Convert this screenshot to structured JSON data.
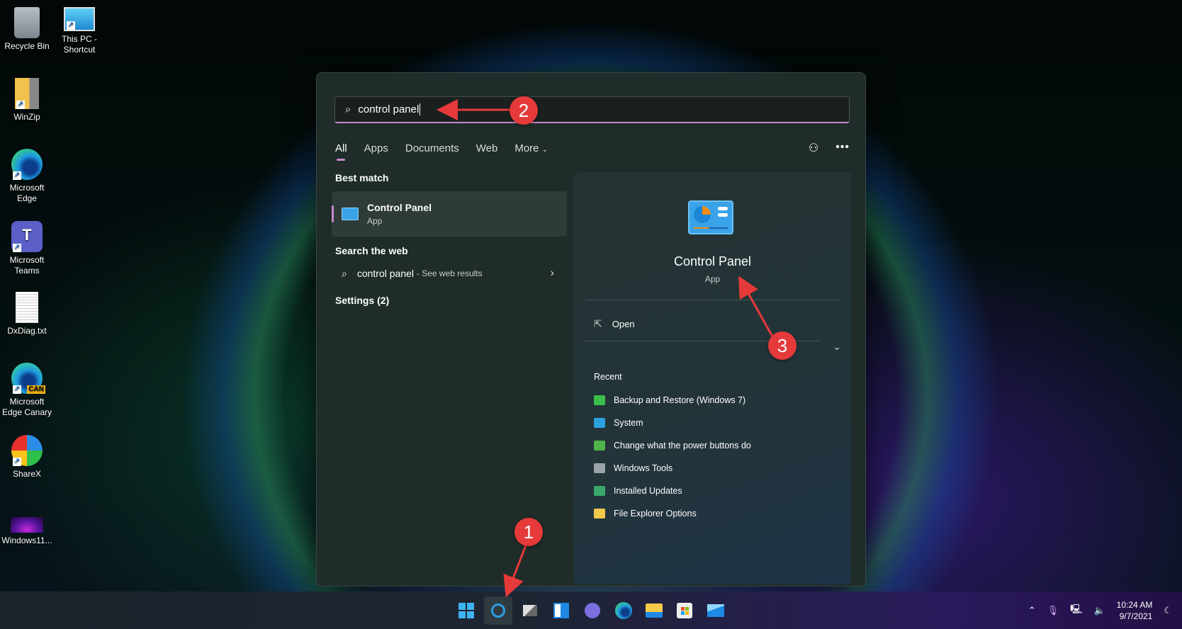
{
  "desktop": {
    "icons": [
      {
        "label": "Recycle Bin",
        "icon": "recycle-bin-icon"
      },
      {
        "label": "This PC - Shortcut",
        "icon": "this-pc-icon"
      },
      {
        "label": "WinZip",
        "icon": "winzip-icon"
      },
      {
        "label": "Microsoft Edge",
        "icon": "edge-icon"
      },
      {
        "label": "Microsoft Teams",
        "icon": "teams-icon"
      },
      {
        "label": "DxDiag.txt",
        "icon": "text-file-icon"
      },
      {
        "label": "Microsoft Edge Canary",
        "icon": "edge-canary-icon",
        "badge": "CAN"
      },
      {
        "label": "ShareX",
        "icon": "sharex-icon"
      },
      {
        "label": "Windows11...",
        "icon": "image-file-icon"
      }
    ]
  },
  "search": {
    "query": "control panel",
    "tabs": [
      "All",
      "Apps",
      "Documents",
      "Web",
      "More"
    ],
    "active_tab": "All",
    "left": {
      "best_match_heading": "Best match",
      "best_match": {
        "title": "Control Panel",
        "subtitle": "App"
      },
      "web_heading": "Search the web",
      "web_result": {
        "query": "control panel",
        "suffix": "- See web results"
      },
      "settings_heading": "Settings (2)"
    },
    "right": {
      "title": "Control Panel",
      "subtitle": "App",
      "open_label": "Open",
      "recent_heading": "Recent",
      "recent": [
        {
          "label": "Backup and Restore (Windows 7)",
          "color": "#3cbf4a"
        },
        {
          "label": "System",
          "color": "#2aa3e0"
        },
        {
          "label": "Change what the power buttons do",
          "color": "#4fb34a"
        },
        {
          "label": "Windows Tools",
          "color": "#9aa3a8"
        },
        {
          "label": "Installed Updates",
          "color": "#3aa86a"
        },
        {
          "label": "File Explorer Options",
          "color": "#f2c94c"
        }
      ]
    }
  },
  "annotations": {
    "callouts": [
      "1",
      "2",
      "3"
    ],
    "color": "#e63a3a"
  },
  "taskbar": {
    "apps": [
      "start",
      "search",
      "task-view",
      "widgets",
      "chat",
      "edge",
      "file-explorer",
      "store",
      "mail"
    ],
    "time": "10:24 AM",
    "date": "9/7/2021"
  },
  "colors": {
    "accent": "#c78ac9",
    "panel": "#1f2c29",
    "callout": "#e63a3a"
  }
}
